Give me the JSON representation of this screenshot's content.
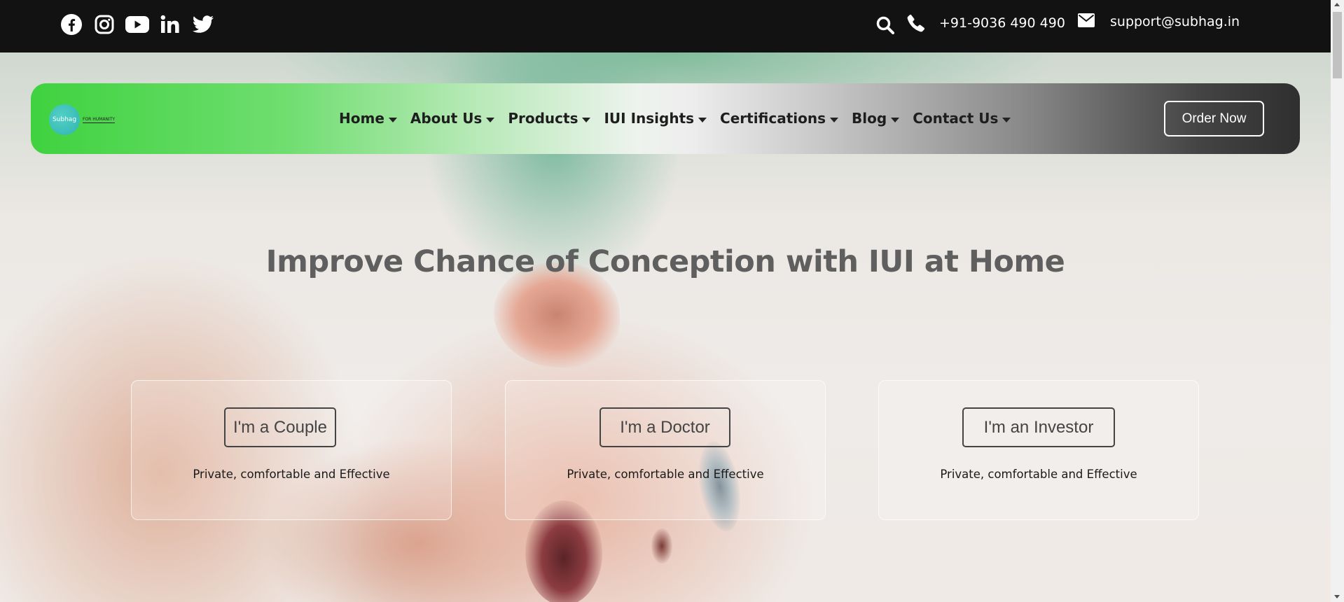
{
  "topbar": {
    "social": [
      {
        "icon": "facebook-icon"
      },
      {
        "icon": "instagram-icon"
      },
      {
        "icon": "youtube-icon"
      },
      {
        "icon": "linkedin-icon"
      },
      {
        "icon": "twitter-icon"
      }
    ],
    "phone": "+91-9036 490 490",
    "email": "support@subhag.in"
  },
  "navbar": {
    "logo_text": "Subhag",
    "logo_tagline": "FOR HUMANITY",
    "menu": [
      {
        "label": "Home"
      },
      {
        "label": "About Us"
      },
      {
        "label": "Products"
      },
      {
        "label": "IUI Insights"
      },
      {
        "label": "Certifications"
      },
      {
        "label": "Blog"
      },
      {
        "label": "Contact Us"
      }
    ],
    "order_button": "Order Now"
  },
  "hero": {
    "headline": "Improve Chance of Conception with IUI at Home",
    "cards": [
      {
        "button": "I'm a Couple",
        "description": "Private, comfortable and Effective"
      },
      {
        "button": "I'm a Doctor",
        "description": "Private, comfortable and Effective"
      },
      {
        "button": "I'm an Investor",
        "description": "Private, comfortable and Effective"
      }
    ]
  },
  "colors": {
    "topbar_bg": "#121212",
    "nav_gradient_start": "#3fd23f",
    "nav_gradient_end": "#2f2f2f",
    "headline": "#5f5f5f"
  }
}
